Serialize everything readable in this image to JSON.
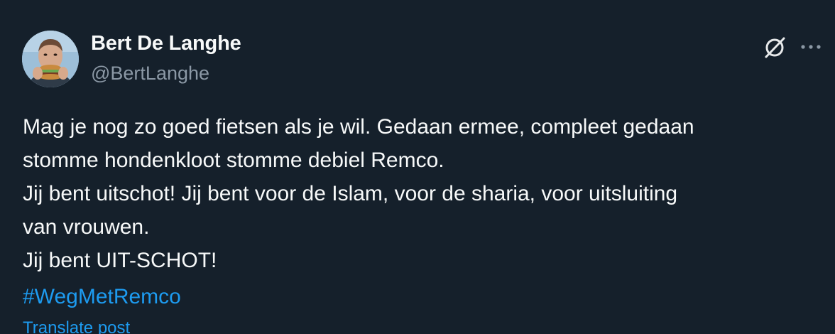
{
  "author": {
    "display_name": "Bert De Langhe",
    "handle": "@BertLanghe"
  },
  "icons": {
    "grok": "grok-icon",
    "more": "more-horizontal-icon"
  },
  "tweet": {
    "lines": [
      "Mag je nog zo goed fietsen als je wil. Gedaan ermee, compleet gedaan",
      "stomme hondenkloot stomme debiel Remco.",
      "Jij bent uitschot! Jij bent voor de Islam, voor de sharia, voor uitsluiting",
      "van vrouwen.",
      "Jij bent UIT-SCHOT!"
    ],
    "hashtag": "#WegMetRemco",
    "translate_label": "Translate post"
  },
  "colors": {
    "background": "#15202b",
    "text_primary": "#f7f9f9",
    "text_secondary": "#8b98a5",
    "link": "#1d9bf0"
  }
}
